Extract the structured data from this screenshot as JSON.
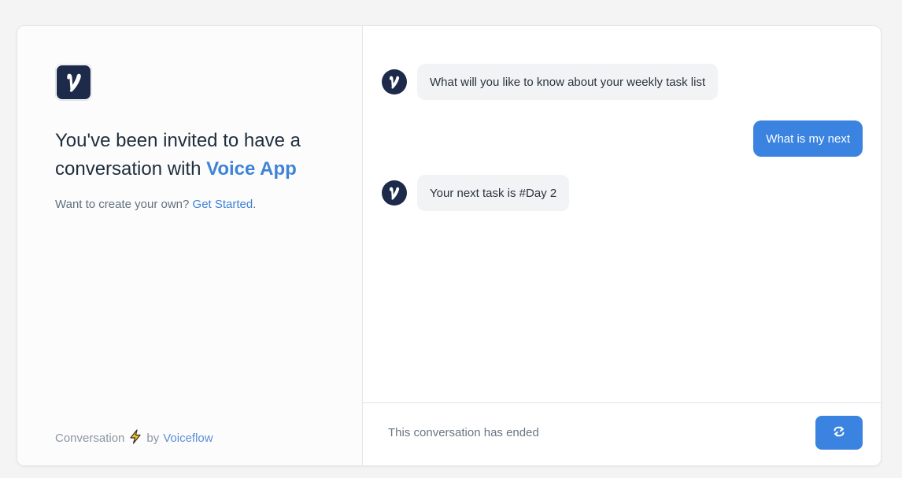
{
  "sidebar": {
    "logo_icon": "voiceflow-v-logo-icon",
    "invite_text": "You've been invited to have a conversation with ",
    "app_name": "Voice App",
    "cta_prefix": "Want to create your own? ",
    "cta_link": "Get Started",
    "cta_suffix": ".",
    "footer_prefix": "Conversation",
    "footer_icon": "lightning-bolt-icon",
    "footer_by": "by",
    "footer_brand": "Voiceflow"
  },
  "chat": {
    "messages": [
      {
        "from": "bot",
        "text": "What will you like to know about your weekly task list"
      },
      {
        "from": "user",
        "text": "What is my next"
      },
      {
        "from": "bot",
        "text": "Your next task is #Day 2"
      }
    ],
    "status_text": "This conversation has ended",
    "restart_icon": "restart-icon"
  },
  "colors": {
    "accent": "#3a83e1",
    "link": "#3f83d6",
    "avatar_bg": "#1e2a4a",
    "bot_bubble": "#f2f3f5"
  }
}
